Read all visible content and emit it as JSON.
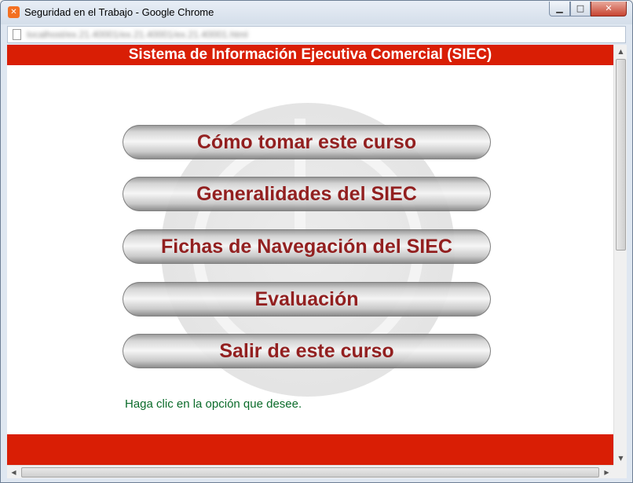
{
  "window": {
    "title": "Seguridad en el Trabajo - Google Chrome",
    "app_icon": "xampp-icon",
    "controls": {
      "minimize_glyph": "▁",
      "maximize_glyph": "□",
      "close_glyph": "✕"
    }
  },
  "address_bar": {
    "url_text": "localhost/ex.21.40001/ex.21.40001/ex.21.40001.html",
    "blurred": true,
    "page_icon": "page-icon"
  },
  "header": {
    "title": "Sistema de Información Ejecutiva Comercial (SIEC)",
    "color": "#d91e05"
  },
  "menu": {
    "items": [
      {
        "label": "Cómo tomar este curso"
      },
      {
        "label": "Generalidades del SIEC"
      },
      {
        "label": "Fichas de Navegación del SIEC"
      },
      {
        "label": "Evaluación"
      },
      {
        "label": "Salir de este curso"
      }
    ],
    "label_color": "#8b0f0f"
  },
  "hint": {
    "text": "Haga clic en la opción que desee.",
    "color": "#0a6b2a"
  },
  "footer": {
    "color": "#d91e05"
  },
  "scrollbars": {
    "vertical": {
      "up_glyph": "▲",
      "down_glyph": "▼"
    },
    "horizontal": {
      "left_glyph": "◀",
      "right_glyph": "▶"
    }
  }
}
